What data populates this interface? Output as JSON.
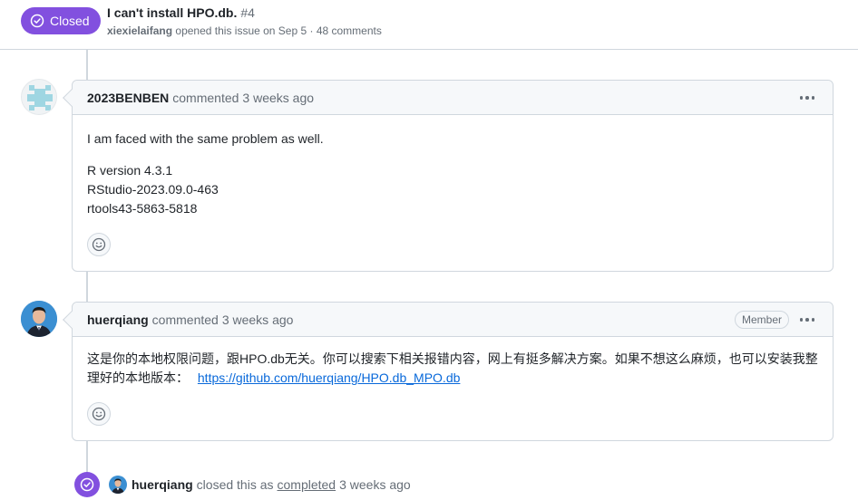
{
  "issue": {
    "state": "Closed",
    "title": "I can't install HPO.db.",
    "number": "#4",
    "author": "xiexielaifang",
    "meta_rest": "opened this issue on Sep 5 · 48 comments"
  },
  "comments": [
    {
      "author": "2023BENBEN",
      "action": "commented",
      "time": "3 weeks ago",
      "body": {
        "p1": "I am faced with the same problem as well.",
        "line1": "R version 4.3.1",
        "line2": "RStudio-2023.09.0-463",
        "line3": "rtools43-5863-5818"
      }
    },
    {
      "author": "huerqiang",
      "action": "commented",
      "time": "3 weeks ago",
      "role": "Member",
      "body": {
        "text": "这是你的本地权限问题，跟HPO.db无关。你可以搜索下相关报错内容，网上有挺多解决方案。如果不想这么麻烦，也可以安装我整理好的本地版本：",
        "link": "https://github.com/huerqiang/HPO.db_MPO.db"
      }
    }
  ],
  "event": {
    "author": "huerqiang",
    "pre": "closed this as",
    "link": "completed",
    "time": "3 weeks ago"
  },
  "colors": {
    "closed_purple": "#8250df",
    "link_blue": "#0969da",
    "border": "#d0d7de",
    "muted": "#656d76"
  },
  "icons": [
    "check-circle-icon",
    "kebab-horizontal-icon",
    "smiley-icon"
  ]
}
